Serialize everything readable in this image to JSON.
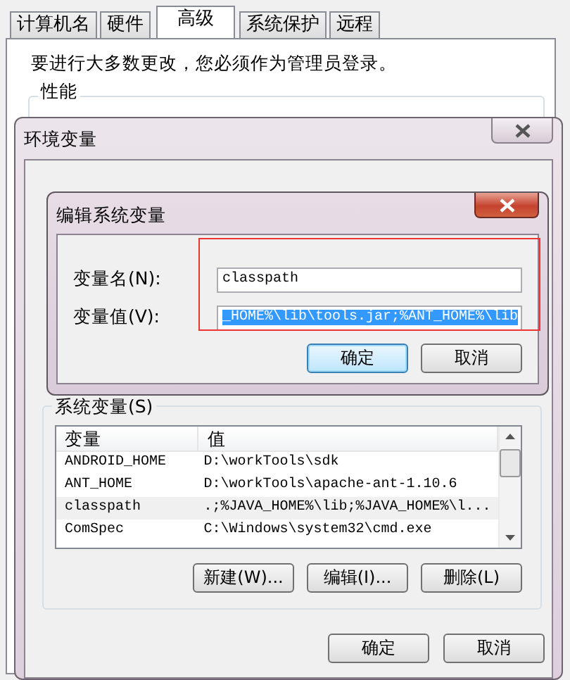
{
  "system_properties": {
    "tabs": [
      {
        "label": "计算机名",
        "selected": false
      },
      {
        "label": "硬件",
        "selected": false
      },
      {
        "label": "高级",
        "selected": true
      },
      {
        "label": "系统保护",
        "selected": false
      },
      {
        "label": "远程",
        "selected": false
      }
    ],
    "notice": "要进行大多数更改，您必须作为管理员登录。",
    "performance_group": {
      "title": "性能"
    }
  },
  "environment_window": {
    "title": "环境变量",
    "system_variables": {
      "title": "系统变量(S)",
      "columns": [
        "变量",
        "值"
      ],
      "rows": [
        {
          "name": "ANDROID_HOME",
          "value": "D:\\workTools\\sdk",
          "selected": false
        },
        {
          "name": "ANT_HOME",
          "value": "D:\\workTools\\apache-ant-1.10.6",
          "selected": false
        },
        {
          "name": "classpath",
          "value": ".;%JAVA_HOME%\\lib;%JAVA_HOME%\\l...",
          "selected": true
        },
        {
          "name": "ComSpec",
          "value": "C:\\Windows\\system32\\cmd.exe",
          "selected": false
        }
      ],
      "buttons": [
        {
          "label": "新建(W)..."
        },
        {
          "label": "编辑(I)..."
        },
        {
          "label": "删除(L)"
        }
      ]
    },
    "buttons": [
      {
        "label": "确定",
        "default": false
      },
      {
        "label": "取消",
        "default": false
      }
    ]
  },
  "edit_dialog": {
    "title": "编辑系统变量",
    "highlight_box": true,
    "fields": [
      {
        "label": "变量名(N):",
        "value": "classpath",
        "text_selected": false
      },
      {
        "label": "变量值(V):",
        "value": "_HOME%\\lib\\tools.jar;%ANT_HOME%\\lib",
        "text_selected": true
      }
    ],
    "buttons": [
      {
        "label": "确定",
        "default": true
      },
      {
        "label": "取消",
        "default": false
      }
    ]
  }
}
